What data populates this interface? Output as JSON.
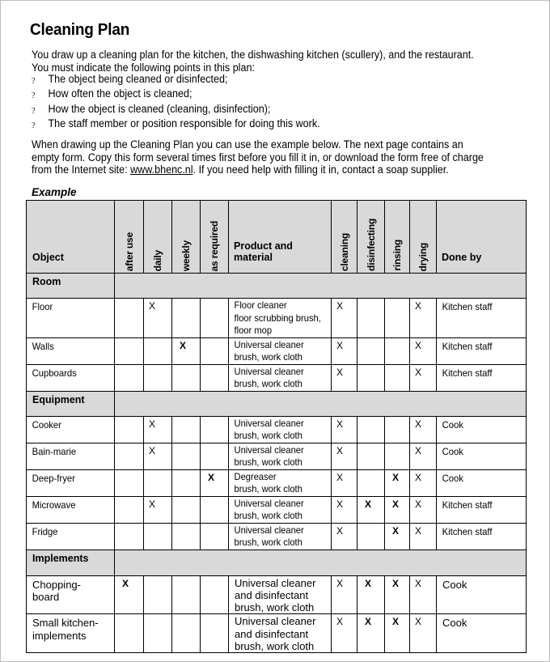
{
  "document": {
    "title": "Cleaning Plan",
    "intro_lines": [
      "You draw up a cleaning plan for the kitchen, the dishwashing kitchen (scullery), and the restaurant.",
      "You must indicate the following points in this plan:"
    ],
    "bullet_mark": "?",
    "bullets": [
      "The object being cleaned or disinfected;",
      "How often the object is cleaned;",
      "How the object is cleaned (cleaning, disinfection);",
      "The staff member or position responsible for doing this work."
    ],
    "para2_lines": [
      "When drawing up the Cleaning Plan you can use the example below. The next page contains an",
      "empty form. Copy this form several times first before you fill it in, or download the form free of charge"
    ],
    "para2_line3_before": "from the Internet site: ",
    "para2_link": "www.bhenc.nl",
    "para2_line3_after": ". If you need help with filling it in, contact a soap supplier.",
    "example_label": "Example"
  },
  "table": {
    "headers": {
      "object": "Object",
      "after_use": "after use",
      "daily": "daily",
      "weekly": "weekly",
      "as_required": "as required",
      "product": "Product and material",
      "cleaning": "cleaning",
      "disinfecting": "disinfecting",
      "rinsing": "rinsing",
      "drying": "drying",
      "done_by": "Done by"
    },
    "sections": [
      {
        "label": "Room",
        "rows": [
          {
            "object": [
              "Floor"
            ],
            "after_use": "",
            "daily": "X",
            "weekly": "",
            "as_required": "",
            "product": [
              "Floor cleaner",
              "floor scrubbing brush,",
              "floor mop"
            ],
            "cleaning": "X",
            "disinfecting": "",
            "rinsing": "",
            "drying": "X",
            "done_by": "Kitchen staff"
          },
          {
            "object": [
              "Walls"
            ],
            "after_use": "",
            "daily": "",
            "weekly": "X",
            "as_required": "",
            "product": [
              "Universal cleaner",
              "brush, work cloth"
            ],
            "cleaning": "X",
            "disinfecting": "",
            "rinsing": "",
            "drying": "X",
            "done_by": "Kitchen staff"
          },
          {
            "object": [
              "Cupboards"
            ],
            "after_use": "",
            "daily": "",
            "weekly": "",
            "as_required": "",
            "product": [
              "Universal cleaner",
              "brush, work cloth"
            ],
            "cleaning": "X",
            "disinfecting": "",
            "rinsing": "",
            "drying": "X",
            "done_by": "Kitchen staff"
          }
        ]
      },
      {
        "label": "Equipment",
        "rows": [
          {
            "object": [
              "Cooker"
            ],
            "after_use": "",
            "daily": "X",
            "weekly": "",
            "as_required": "",
            "product": [
              "Universal cleaner",
              "brush, work cloth"
            ],
            "cleaning": "X",
            "disinfecting": "",
            "rinsing": "",
            "drying": "X",
            "done_by": "Cook"
          },
          {
            "object": [
              "Bain-marie"
            ],
            "after_use": "",
            "daily": "X",
            "weekly": "",
            "as_required": "",
            "product": [
              "Universal cleaner",
              "brush, work cloth"
            ],
            "cleaning": "X",
            "disinfecting": "",
            "rinsing": "",
            "drying": "X",
            "done_by": "Cook"
          },
          {
            "object": [
              "Deep-fryer"
            ],
            "after_use": "",
            "daily": "",
            "weekly": "",
            "as_required": "X",
            "product": [
              "Degreaser",
              "brush, work cloth"
            ],
            "cleaning": "X",
            "disinfecting": "",
            "rinsing": "X",
            "drying": "X",
            "done_by": "Cook"
          },
          {
            "object": [
              "Microwave"
            ],
            "after_use": "",
            "daily": "X",
            "weekly": "",
            "as_required": "",
            "product": [
              "Universal cleaner",
              "brush, work cloth"
            ],
            "cleaning": "X",
            "disinfecting": "X",
            "rinsing": "X",
            "drying": "X",
            "done_by": "Kitchen staff"
          },
          {
            "object": [
              "Fridge"
            ],
            "after_use": "",
            "daily": "",
            "weekly": "",
            "as_required": "",
            "product": [
              "Universal cleaner",
              "brush, work cloth"
            ],
            "cleaning": "X",
            "disinfecting": "",
            "rinsing": "X",
            "drying": "X",
            "done_by": "Kitchen staff"
          }
        ]
      },
      {
        "label": "Implements",
        "rows": [
          {
            "object": [
              "Chopping-",
              "board"
            ],
            "after_use": "X",
            "daily": "",
            "weekly": "",
            "as_required": "",
            "product": [
              "Universal cleaner",
              "and disinfectant",
              "brush, work cloth"
            ],
            "cleaning": "X",
            "disinfecting": "X",
            "rinsing": "X",
            "drying": "X",
            "done_by": "Cook"
          },
          {
            "object": [
              "Small kitchen-",
              "implements"
            ],
            "after_use": "",
            "daily": "",
            "weekly": "",
            "as_required": "",
            "product": [
              "Universal cleaner",
              "and disinfectant",
              "brush, work cloth"
            ],
            "cleaning": "X",
            "disinfecting": "X",
            "rinsing": "X",
            "drying": "X",
            "done_by": "Cook"
          }
        ]
      }
    ]
  }
}
